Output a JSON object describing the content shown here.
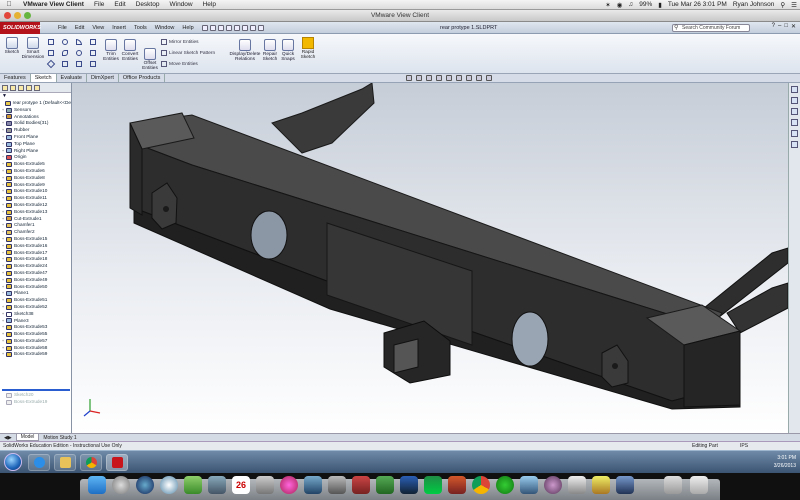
{
  "mac_menubar": {
    "apple": "",
    "app_name": "VMware View Client",
    "menus": [
      "File",
      "Edit",
      "Desktop",
      "Window",
      "Help"
    ],
    "battery": "99%",
    "clock": "Tue Mar 26  3:01 PM",
    "user": "Ryan Johnson"
  },
  "vmware": {
    "title": "VMware View Client"
  },
  "solidworks": {
    "logo": "SOLIDWORKS",
    "menus": [
      "File",
      "Edit",
      "View",
      "Insert",
      "Tools",
      "Window",
      "Help"
    ],
    "document_title": "rear protype 1.SLDPRT",
    "search_placeholder": "Search Community Forum"
  },
  "command_manager": {
    "sketch": "Sketch",
    "smart_dimension": "Smart Dimension",
    "offset_entities": "Offset Entities",
    "trim_entities": "Trim Entities",
    "convert_entities": "Convert Entities",
    "mirror_entities": "Mirror Entities",
    "linear_sketch_pattern": "Linear Sketch Pattern",
    "move_entities": "Move Entities",
    "display_delete_relations": "Display/Delete Relations",
    "repair_sketch": "Repair Sketch",
    "quick_snaps": "Quick Snaps",
    "rapid_sketch": "Rapid Sketch"
  },
  "tabs": [
    "Features",
    "Sketch",
    "Evaluate",
    "DimXpert",
    "Office Products"
  ],
  "active_tab": "Sketch",
  "tree": {
    "root": "rear protype 1  (Default<<De",
    "items": [
      "Sensors",
      "Annotations",
      "Solid Bodies(31)",
      "Rubber",
      "Front Plane",
      "Top Plane",
      "Right Plane",
      "Origin",
      "Boss-Extrude5",
      "Boss-Extrude6",
      "Boss-Extrude8",
      "Boss-Extrude9",
      "Boss-Extrude10",
      "Boss-Extrude11",
      "Boss-Extrude12",
      "Boss-Extrude13",
      "Cut-Extrude1",
      "Chamfer1",
      "Chamfer2",
      "Boss-Extrude15",
      "Boss-Extrude16",
      "Boss-Extrude17",
      "Boss-Extrude18",
      "Boss-Extrude24",
      "Boss-Extrude47",
      "Boss-Extrude49",
      "Boss-Extrude50",
      "Plane1",
      "Boss-Extrude51",
      "Boss-Extrude52",
      "Sketch38",
      "Plane3",
      "Boss-Extrude53",
      "Boss-Extrude55",
      "Boss-Extrude57",
      "Boss-Extrude58",
      "Boss-Extrude59"
    ],
    "rolled_back": [
      "Sketch20",
      "Boss-Extrude19"
    ]
  },
  "model_tabs": [
    "Model",
    "Motion Study 1"
  ],
  "status": {
    "left": "SolidWorks Education Edition - Instructional Use Only",
    "mode": "Editing Part",
    "units": "IPS"
  },
  "win_tray": {
    "time": "3:01 PM",
    "date": "3/26/2013"
  },
  "dock": {
    "calendar_day": "26"
  },
  "colors": {
    "sw_red": "#b3121b",
    "part_fill": "#2b2b2b",
    "viewport_top": "#c6cdd7",
    "viewport_bottom": "#ffffff"
  }
}
